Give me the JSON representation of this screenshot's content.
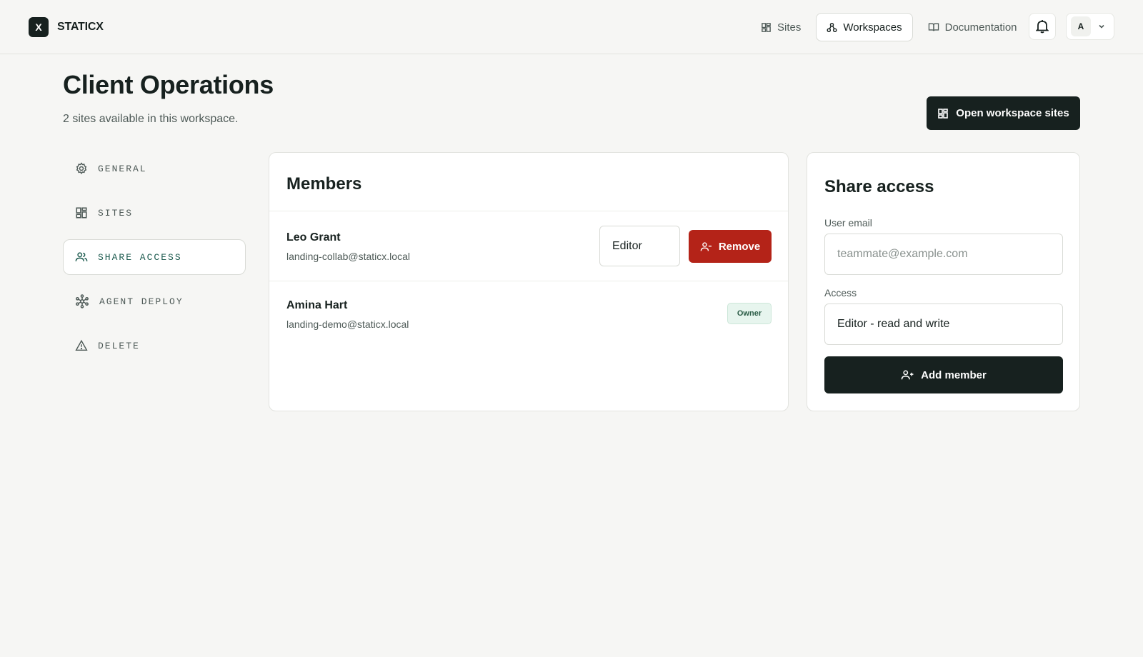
{
  "brand": {
    "mark": "X",
    "name": "STATICX"
  },
  "nav": {
    "items": [
      {
        "label": "Sites",
        "icon": "grid-icon",
        "active": false
      },
      {
        "label": "Workspaces",
        "icon": "workspaces-icon",
        "active": true
      },
      {
        "label": "Documentation",
        "icon": "book-icon",
        "active": false
      }
    ]
  },
  "account": {
    "initial": "A"
  },
  "header": {
    "title": "Client Operations",
    "subtitle": "2 sites available in this workspace.",
    "open_sites_label": "Open workspace sites"
  },
  "sidebar": {
    "items": [
      {
        "label": "GENERAL",
        "icon": "gear-icon",
        "active": false
      },
      {
        "label": "SITES",
        "icon": "grid-icon",
        "active": false
      },
      {
        "label": "SHARE ACCESS",
        "icon": "users-icon",
        "active": true
      },
      {
        "label": "AGENT DEPLOY",
        "icon": "network-icon",
        "active": false
      },
      {
        "label": "DELETE",
        "icon": "warning-icon",
        "active": false
      }
    ]
  },
  "members": {
    "title": "Members",
    "list": [
      {
        "name": "Leo Grant",
        "email": "landing-collab@staticx.local",
        "role": "Editor",
        "remove_label": "Remove"
      },
      {
        "name": "Amina Hart",
        "email": "landing-demo@staticx.local",
        "badge": "Owner"
      }
    ]
  },
  "share": {
    "title": "Share access",
    "email_label": "User email",
    "email_placeholder": "teammate@example.com",
    "email_value": "",
    "access_label": "Access",
    "access_value": "Editor - read and write",
    "add_label": "Add member"
  },
  "colors": {
    "primary": "#17211f",
    "danger": "#b42318",
    "accent": "#1d5b4f",
    "background": "#f6f6f4",
    "owner_badge_bg": "#e7f5ee"
  }
}
